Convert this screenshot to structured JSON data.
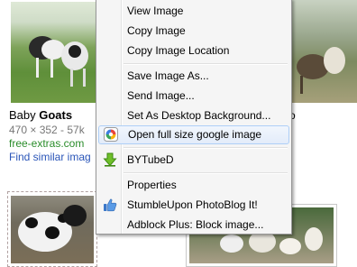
{
  "results": {
    "card1": {
      "title_prefix": "Baby ",
      "title_bold": "Goats",
      "size_text": "470 × 352 - 57k",
      "domain": "free-extras.com",
      "similar_link": "Find similar imag"
    },
    "card2_caption_tail": "o"
  },
  "context_menu": {
    "items": [
      {
        "label": "View Image"
      },
      {
        "label": "Copy Image"
      },
      {
        "label": "Copy Image Location"
      },
      {
        "label": "Save Image As..."
      },
      {
        "label": "Send Image..."
      },
      {
        "label": "Set As Desktop Background..."
      },
      {
        "label": "Open full size google image",
        "icon": "google-image-icon",
        "highlighted": true
      },
      {
        "label": "BYTubeD",
        "icon": "download-arrow-icon"
      },
      {
        "label": "Properties"
      },
      {
        "label": "StumbleUpon PhotoBlog It!",
        "icon": "thumbs-up-icon"
      },
      {
        "label": "Adblock Plus: Block image..."
      }
    ]
  },
  "colors": {
    "menu_bg": "#f5f5f5",
    "highlight_border": "#aecff7",
    "link_blue": "#2a55b8",
    "domain_green": "#2a8c2a"
  }
}
